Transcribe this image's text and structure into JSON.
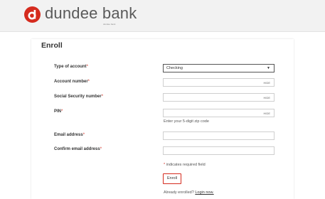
{
  "brand": {
    "name": "dundee bank",
    "subtext": "dundee bank",
    "accent_color": "#d52b1e"
  },
  "page": {
    "title": "Enroll"
  },
  "form": {
    "required_mark": "*",
    "type_of_account": {
      "label": "Type of account",
      "value": "Checking"
    },
    "account_number": {
      "label": "Account number",
      "value": "",
      "toggle": "HIDE"
    },
    "ssn": {
      "label": "Social Security number",
      "value": "",
      "toggle": "HIDE"
    },
    "pin": {
      "label": "PIN",
      "value": "",
      "toggle": "HIDE",
      "hint": "Enter your 5-digit zip code"
    },
    "email": {
      "label": "Email address",
      "value": ""
    },
    "confirm_email": {
      "label": "Confirm email address",
      "value": ""
    },
    "required_note": "indicates required field",
    "submit_label": "Enroll",
    "already_text": "Already enrolled?",
    "login_link": "Login now."
  }
}
